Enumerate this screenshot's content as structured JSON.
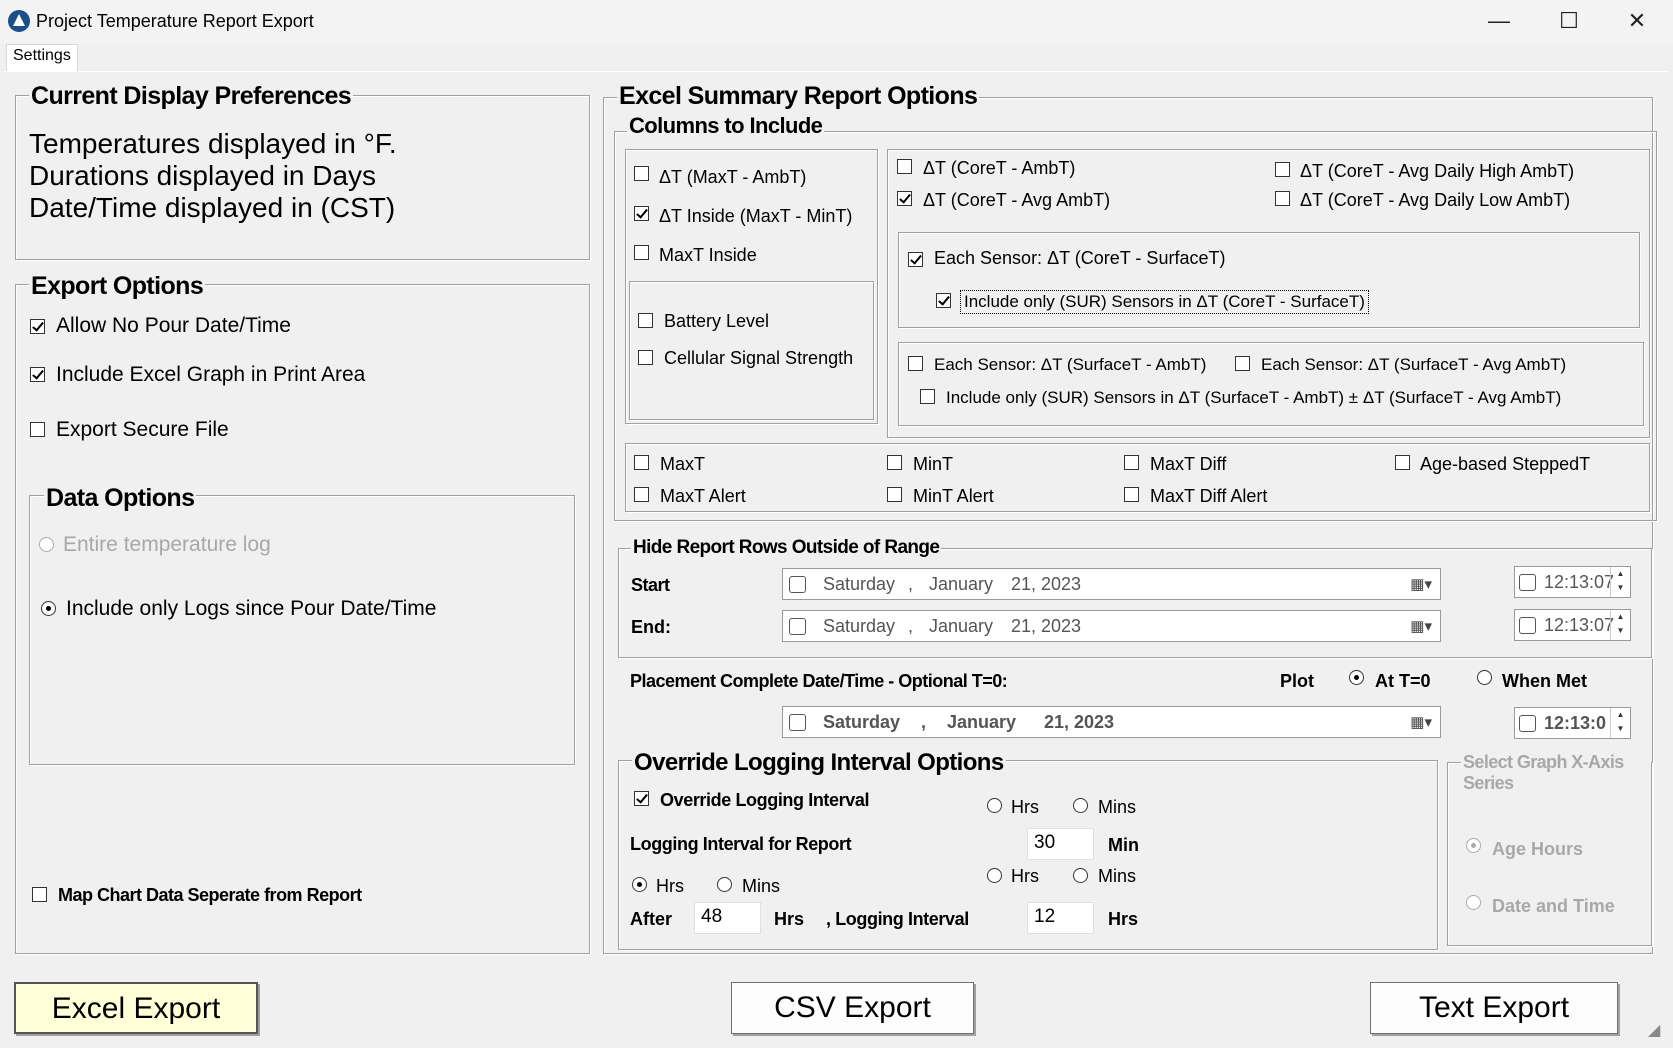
{
  "window": {
    "title": "Project Temperature Report Export"
  },
  "menu": {
    "settings": "Settings"
  },
  "display_prefs": {
    "title": "Current Display Preferences",
    "line1": "Temperatures displayed in °F.",
    "line2": "Durations displayed in Days",
    "line3": "Date/Time displayed in (CST)"
  },
  "export_options": {
    "title": "Export Options",
    "allow_no_pour": "Allow No Pour Date/Time",
    "include_graph": "Include Excel Graph in Print Area",
    "secure_file": "Export Secure File",
    "data_options": {
      "title": "Data Options",
      "entire_log": "Entire temperature log",
      "since_pour": "Include only Logs since Pour Date/Time"
    },
    "map_chart": "Map Chart Data Seperate from Report"
  },
  "excel_options": {
    "title": "Excel Summary Report Options",
    "columns_title": "Columns to Include",
    "col_left": {
      "dt_max_amb": "ΔT (MaxT - AmbT)",
      "dt_inside": "ΔT Inside (MaxT - MinT)",
      "maxt_inside": "MaxT Inside",
      "battery": "Battery Level",
      "cellular": "Cellular Signal Strength"
    },
    "col_right": {
      "core_amb": "ΔT (CoreT - AmbT)",
      "core_avg_amb": "ΔT (CoreT - Avg AmbT)",
      "core_avg_high": "ΔT (CoreT - Avg Daily High AmbT)",
      "core_avg_low": "ΔT (CoreT - Avg Daily Low AmbT)",
      "each_core_surface": "Each Sensor: ΔT (CoreT - SurfaceT)",
      "only_sur_core": "Include only (SUR) Sensors in ΔT (CoreT - SurfaceT)",
      "each_surface_amb": "Each Sensor: ΔT (SurfaceT - AmbT)",
      "each_surface_avg": "Each Sensor: ΔT (SurfaceT - Avg AmbT)",
      "only_sur_surface": "Include only (SUR) Sensors in ΔT (SurfaceT - AmbT) ± ΔT (SurfaceT - Avg AmbT)"
    },
    "bottom": {
      "maxt": "MaxT",
      "mint": "MinT",
      "maxt_diff": "MaxT Diff",
      "age_stepped": "Age-based SteppedT",
      "maxt_alert": "MaxT Alert",
      "mint_alert": "MinT Alert",
      "maxt_diff_alert": "MaxT Diff Alert"
    }
  },
  "hide_rows": {
    "title": "Hide Report Rows Outside of Range",
    "start_label": "Start",
    "end_label": "End:",
    "start_day": "Saturday",
    "start_sep": ",",
    "start_month": "January",
    "start_date": "21, 2023",
    "start_time": "12:13:07",
    "end_day": "Saturday",
    "end_sep": ",",
    "end_month": "January",
    "end_date": "21, 2023",
    "end_time": "12:13:07"
  },
  "placement": {
    "label": "Placement Complete Date/Time - Optional T=0:",
    "plot": "Plot",
    "at_t0": "At T=0",
    "when_met": "When Met",
    "day": "Saturday",
    "sep": ",",
    "month": "January",
    "date": "21, 2023",
    "time": "12:13:0"
  },
  "override": {
    "title": "Override Logging Interval Options",
    "checkbox": "Override Logging Interval",
    "hrs": "Hrs",
    "mins": "Mins",
    "interval_label": "Logging Interval for Report",
    "interval_value": "30",
    "interval_unit": "Min",
    "after": "After",
    "after_value": "48",
    "after_unit": "Hrs",
    "logging_interval": ", Logging Interval",
    "logging_value": "12",
    "logging_unit": "Hrs"
  },
  "xaxis": {
    "title": "Select Graph X-Axis Series",
    "age_hours": "Age Hours",
    "date_time": "Date and Time"
  },
  "buttons": {
    "excel": "Excel Export",
    "csv": "CSV Export",
    "text": "Text Export"
  }
}
